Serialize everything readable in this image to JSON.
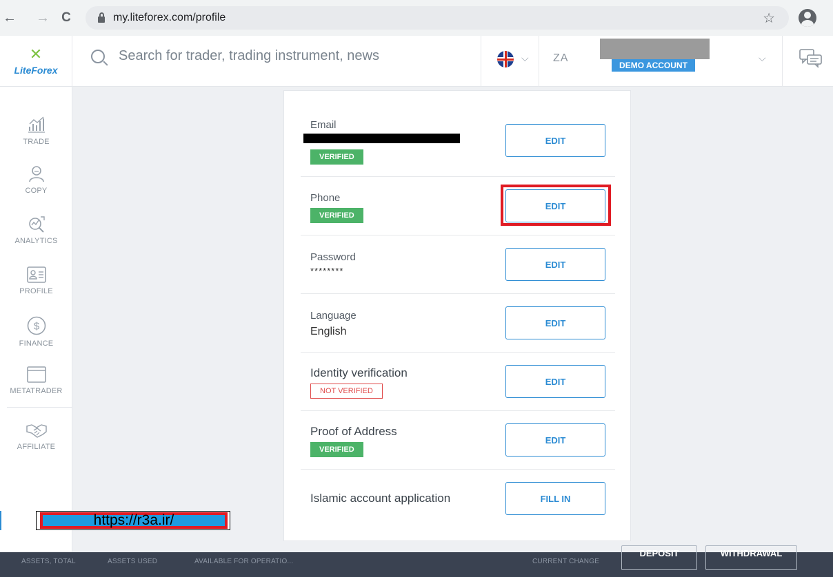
{
  "browser": {
    "back_glyph": "←",
    "forward_glyph": "→",
    "reload_glyph": "C",
    "url": "my.liteforex.com/profile",
    "star_glyph": "☆"
  },
  "header": {
    "logo_mark": "✕",
    "logo_text": "LiteForex",
    "search_placeholder": "Search for trader, trading instrument, news",
    "account_prefix": "ZA",
    "account_badge": "DEMO ACCOUNT",
    "chevron": "⌵"
  },
  "sidebar": {
    "items": [
      {
        "label": "TRADE",
        "icon": "chart-icon"
      },
      {
        "label": "COPY",
        "icon": "user-icon"
      },
      {
        "label": "ANALYTICS",
        "icon": "analytics-icon"
      },
      {
        "label": "PROFILE",
        "icon": "id-card-icon"
      },
      {
        "label": "FINANCE",
        "icon": "dollar-coin-icon"
      },
      {
        "label": "METATRADER",
        "icon": "window-icon"
      },
      {
        "label": "AFFILIATE",
        "icon": "handshake-icon"
      }
    ]
  },
  "profile": {
    "rows": [
      {
        "label": "Email",
        "badge": "VERIFIED",
        "button": "EDIT"
      },
      {
        "label": "Phone",
        "badge": "VERIFIED",
        "button": "EDIT"
      },
      {
        "label": "Password",
        "value": "********",
        "button": "EDIT"
      },
      {
        "label": "Language",
        "value": "English",
        "button": "EDIT"
      },
      {
        "label": "Identity verification",
        "badge": "NOT VERIFIED",
        "button": "EDIT"
      },
      {
        "label": "Proof of Address",
        "badge": "VERIFIED",
        "button": "EDIT"
      },
      {
        "label": "Islamic account application",
        "button": "FILL IN"
      }
    ]
  },
  "watermark": {
    "text": "https://r3a.ir/"
  },
  "bottom_bar": {
    "assets_total": "ASSETS, TOTAL",
    "assets_used": "ASSETS USED",
    "available": "AVAILABLE FOR OPERATIO...",
    "current_change": "CURRENT CHANGE",
    "deposit": "DEPOSIT",
    "withdrawal": "WITHDRAWAL"
  },
  "colors": {
    "accent": "#2b8bd3",
    "verified": "#4cb368",
    "not_verified": "#e04b4b",
    "highlight": "#e01b24",
    "bottom_bar": "#3a4251"
  }
}
